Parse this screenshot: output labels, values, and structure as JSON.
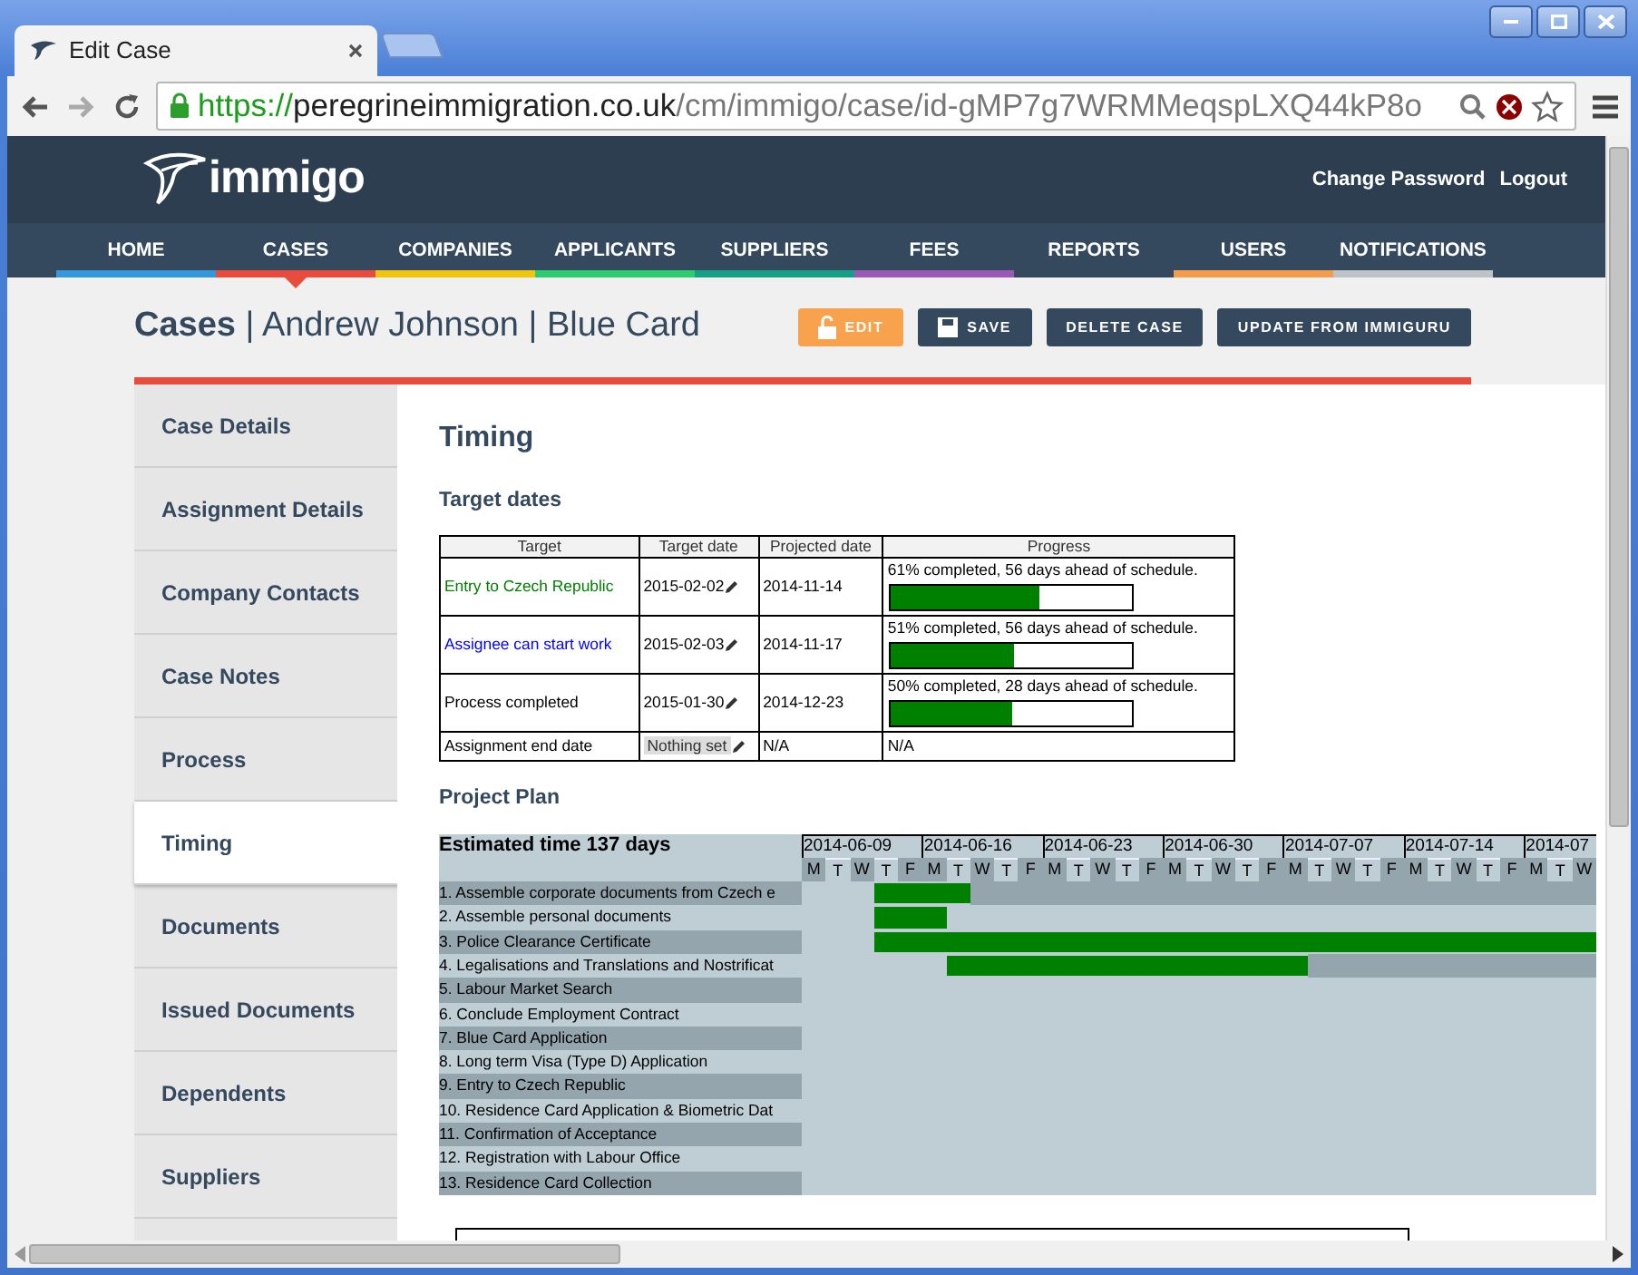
{
  "browser": {
    "tab_title": "Edit Case",
    "url_scheme": "https://",
    "url_host": "peregrineimmigration.co.uk",
    "url_path": "/cm/immigo/case/id-gMP7g7WRMMeqspLXQ44kP8o"
  },
  "header": {
    "logo": "immigo",
    "links": [
      "Change Password",
      "Logout"
    ]
  },
  "nav": [
    {
      "label": "HOME",
      "selected": false,
      "color": "#3498db"
    },
    {
      "label": "CASES",
      "selected": true,
      "color": "#e74c3c"
    },
    {
      "label": "COMPANIES",
      "selected": false,
      "color": "#f1c40f"
    },
    {
      "label": "APPLICANTS",
      "selected": false,
      "color": "#2ecc71"
    },
    {
      "label": "SUPPLIERS",
      "selected": false,
      "color": "#16a085"
    },
    {
      "label": "FEES",
      "selected": false,
      "color": "#9b59b6"
    },
    {
      "label": "REPORTS",
      "selected": false
    },
    {
      "label": "USERS",
      "selected": false,
      "color": "#f39c4d"
    },
    {
      "label": "NOTIFICATIONS",
      "selected": false,
      "color": "#bdc3c7"
    }
  ],
  "page_title": "**Cases** | Andrew Johnson | Blue Card",
  "actions": [
    {
      "label": "EDIT",
      "kind": "edit"
    },
    {
      "label": "SAVE",
      "kind": "save"
    },
    {
      "label": "DELETE CASE",
      "kind": "plain"
    },
    {
      "label": "UPDATE FROM IMMIGURU",
      "kind": "plain"
    }
  ],
  "sidebar": {
    "items": [
      {
        "label": "Case Details",
        "selected": false
      },
      {
        "label": "Assignment Details",
        "selected": false
      },
      {
        "label": "Company Contacts",
        "selected": false
      },
      {
        "label": "Case Notes",
        "selected": false
      },
      {
        "label": "Process",
        "selected": false
      },
      {
        "label": "Timing",
        "selected": true
      },
      {
        "label": "Documents",
        "selected": false
      },
      {
        "label": "Issued Documents",
        "selected": false
      },
      {
        "label": "Dependents",
        "selected": false
      },
      {
        "label": "Suppliers",
        "selected": false
      }
    ]
  },
  "section_title": "Timing",
  "target_dates": {
    "title": "Target dates",
    "columns": [
      "Target",
      "Target date",
      "Projected date",
      "Progress"
    ],
    "rows": [
      {
        "target": "Entry to Czech Republic",
        "color": "#008000",
        "target_date": "2015-02-02",
        "date_set": true,
        "projected": "2014-11-14",
        "progress_text": "61% completed, 56 days ahead of schedule.",
        "level": 0.61
      },
      {
        "target": "Assignee can start work",
        "color": "#0000ff",
        "target_date": "2015-02-03",
        "date_set": true,
        "projected": "2014-11-17",
        "progress_text": "51% completed, 56 days ahead of schedule.",
        "level": 0.51
      },
      {
        "target": "Process completed",
        "color": "#000000",
        "target_date": "2015-01-30",
        "date_set": true,
        "projected": "2014-12-23",
        "progress_text": "50% completed, 28 days ahead of schedule.",
        "level": 0.5
      },
      {
        "target": "Assignment end date",
        "color": "#000000",
        "target_date": "Nothing set",
        "date_set": false,
        "projected": "N/A",
        "progress_text": "N/A"
      }
    ]
  },
  "project_plan": {
    "title": "Project Plan",
    "estimate": "Estimated time 137 days",
    "weeks": [
      {
        "date": "2014-06-09",
        "days": [
          "M",
          "T",
          "W",
          "T",
          "F"
        ]
      },
      {
        "date": "2014-06-16",
        "days": [
          "M",
          "T",
          "W",
          "T",
          "F"
        ]
      },
      {
        "date": "2014-06-23",
        "days": [
          "M",
          "T",
          "W",
          "T",
          "F"
        ]
      },
      {
        "date": "2014-06-30",
        "days": [
          "M",
          "T",
          "W",
          "T",
          "F"
        ]
      },
      {
        "date": "2014-07-07",
        "days": [
          "M",
          "T",
          "W",
          "T",
          "F"
        ]
      },
      {
        "date": "2014-07-14",
        "days": [
          "M",
          "T",
          "W",
          "T",
          "F"
        ]
      },
      {
        "date": "2014-07",
        "days": [
          "M",
          "T",
          "W"
        ]
      }
    ],
    "tasks": [
      {
        "label": "1. Assemble corporate documents from Czech e",
        "tail": true,
        "filled": [
          false,
          false,
          false,
          true,
          true,
          true,
          true,
          false,
          false,
          false,
          false,
          false,
          false,
          false,
          false,
          false,
          false,
          false,
          false,
          false,
          false,
          false,
          false,
          false,
          false,
          false,
          false,
          false,
          false,
          false,
          false,
          false,
          false
        ]
      },
      {
        "label": "2. Assemble personal documents",
        "tail": false,
        "filled": [
          false,
          false,
          false,
          true,
          true,
          true,
          false,
          false,
          false,
          false,
          false,
          false,
          false,
          false,
          false,
          false,
          false,
          false,
          false,
          false,
          false,
          false,
          false,
          false,
          false,
          false,
          false,
          false,
          false,
          false,
          false,
          false,
          false
        ]
      },
      {
        "label": "3. Police Clearance Certificate",
        "filled": [
          false,
          false,
          false,
          true,
          true,
          true,
          true,
          true,
          true,
          true,
          true,
          true,
          true,
          true,
          true,
          true,
          true,
          true,
          true,
          true,
          true,
          true,
          true,
          true,
          true,
          true,
          true,
          true,
          true,
          true,
          true,
          true,
          true
        ]
      },
      {
        "label": "4. Legalisations and Translations and Nostrificat",
        "tail": true,
        "filled": [
          false,
          false,
          false,
          false,
          false,
          false,
          true,
          true,
          true,
          true,
          true,
          true,
          true,
          true,
          true,
          true,
          true,
          true,
          true,
          true,
          true,
          false,
          false,
          false,
          false,
          false,
          false,
          false,
          false,
          false,
          false,
          false,
          false
        ]
      },
      {
        "label": "5. Labour Market Search"
      },
      {
        "label": "6. Conclude Employment Contract"
      },
      {
        "label": "7. Blue Card Application"
      },
      {
        "label": "8. Long term Visa (Type D) Application"
      },
      {
        "label": "9. Entry to Czech Republic"
      },
      {
        "label": "10. Residence Card Application & Biometric Dat"
      },
      {
        "label": "11. Confirmation of Acceptance"
      },
      {
        "label": "12. Registration with Labour Office"
      },
      {
        "label": "13. Residence Card Collection"
      }
    ]
  }
}
